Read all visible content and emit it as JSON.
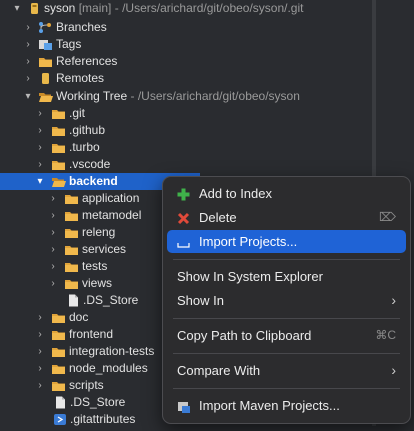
{
  "tree": {
    "repo": {
      "label": "syson",
      "branch": "[main]",
      "path": "- /Users/arichard/git/obeo/syson/.git"
    },
    "branches": "Branches",
    "tags": "Tags",
    "references": "References",
    "remotes": "Remotes",
    "working_tree": {
      "label": "Working Tree",
      "path": "- /Users/arichard/git/obeo/syson"
    },
    "wt_folders_top": [
      ".git",
      ".github",
      ".turbo",
      ".vscode"
    ],
    "backend": "backend",
    "backend_children": [
      "application",
      "metamodel",
      "releng",
      "services",
      "tests",
      "views"
    ],
    "backend_file": ".DS_Store",
    "wt_folders_bottom": [
      "doc",
      "frontend",
      "integration-tests",
      "node_modules",
      "scripts"
    ],
    "wt_files": [
      ".DS_Store",
      ".gitattributes"
    ]
  },
  "context_menu": {
    "add_to_index": "Add to Index",
    "delete": "Delete",
    "import_projects": "Import Projects...",
    "show_in_system_explorer": "Show In System Explorer",
    "show_in": "Show In",
    "copy_path": "Copy Path to Clipboard",
    "copy_path_shortcut": "⌘C",
    "compare_with": "Compare With",
    "import_maven": "Import Maven Projects..."
  },
  "colors": {
    "selection": "#1f62c9",
    "menu_highlight": "#1f63d6",
    "folder": "#e0a33a",
    "add_icon": "#3fb24a",
    "delete_icon": "#e04a3a"
  },
  "icons": {
    "folder": "folder-icon",
    "repo": "git-repository-icon",
    "branches": "branches-icon",
    "tags": "tags-icon",
    "file": "file-icon",
    "add": "add-plus-icon",
    "delete": "delete-x-icon",
    "import": "import-icon",
    "maven": "maven-import-icon"
  }
}
